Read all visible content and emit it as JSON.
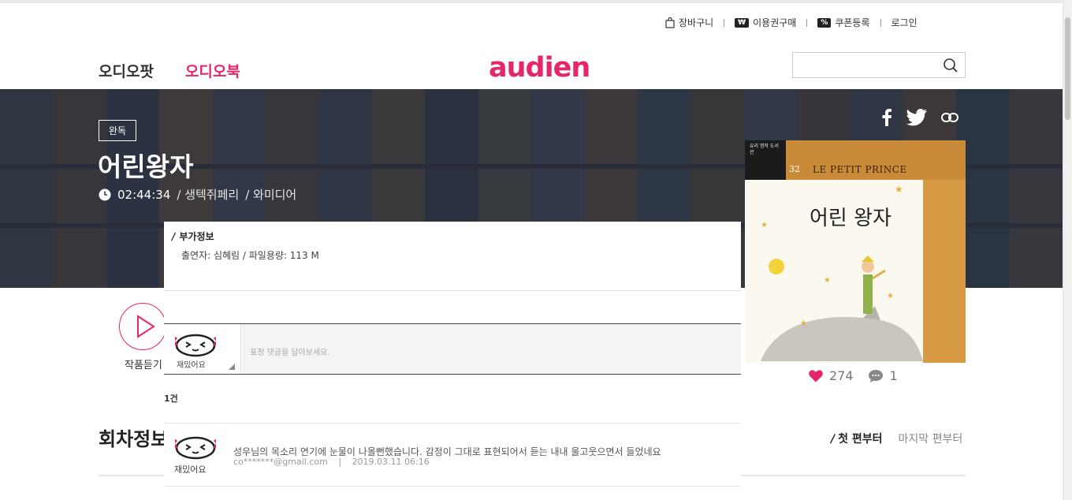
{
  "util_nav": {
    "cart": "장바구니",
    "ticket_badge": "₩",
    "ticket": "이용권구매",
    "coupon_badge": "%",
    "coupon": "쿠폰등록",
    "login": "로그인"
  },
  "gnb": {
    "audiopot": "오디오팟",
    "audiobook": "오디오북"
  },
  "logo": "audien",
  "search": {
    "placeholder": ""
  },
  "hero": {
    "status": "완독",
    "title": "어린왕자",
    "duration": "02:44:34",
    "author": "/ 생텍쥐페리",
    "publisher": "/ 와미디어"
  },
  "cover": {
    "series": "유리 명작 도서관",
    "number": "32",
    "english_title": "LE PETIT PRINCE",
    "korean_title": "어린 왕자"
  },
  "stats": {
    "likes": "274",
    "comments": "1"
  },
  "play": {
    "label": "작품듣기"
  },
  "panel": {
    "section_title": "부가정보",
    "info": "출연자: 심혜림   /   파일용량: 113 M",
    "emotion_label": "재밌어요",
    "placeholder": "표정 댓글을 달아보세요.",
    "count": "1건",
    "comment": {
      "emotion": "재밌어요",
      "text": "성우님의 목소리 연기에 눈물이 나올뻔했습니다. 감정이 그대로 표현되어서 듣는 내내 울고웃으면서 들었네요",
      "author": "co*******@gmail.com",
      "date": "2019.03.11 06:16"
    }
  },
  "episodes": {
    "title": "회차정보",
    "sort_first": "첫 편부터",
    "sort_last": "마지막 편부터"
  },
  "colors": {
    "accent": "#e6266b",
    "hero_bg": "#3a4150"
  }
}
